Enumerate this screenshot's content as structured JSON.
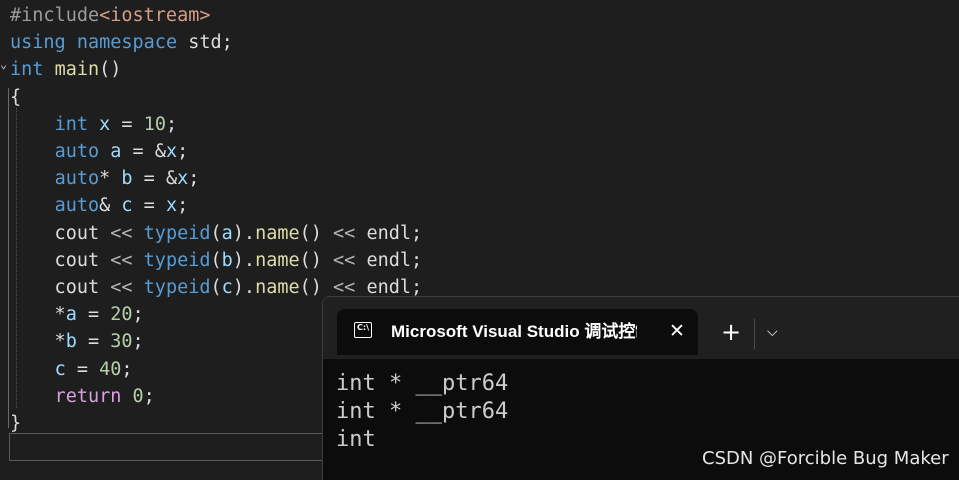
{
  "editor": {
    "lines": [
      [
        {
          "t": "#include",
          "c": "tok-pp"
        },
        {
          "t": "<iostream>",
          "c": "tok-inc"
        }
      ],
      [
        {
          "t": "using",
          "c": "tok-kw"
        },
        {
          "t": " ",
          "c": "tok-plain"
        },
        {
          "t": "namespace",
          "c": "tok-kw"
        },
        {
          "t": " std;",
          "c": "tok-plain"
        }
      ],
      [
        {
          "t": "int",
          "c": "tok-kw"
        },
        {
          "t": " ",
          "c": "tok-plain"
        },
        {
          "t": "main",
          "c": "tok-fn"
        },
        {
          "t": "()",
          "c": "tok-plain"
        }
      ],
      [
        {
          "t": "{",
          "c": "tok-plain"
        }
      ],
      [
        {
          "t": "    ",
          "c": "tok-plain"
        },
        {
          "t": "int",
          "c": "tok-kw"
        },
        {
          "t": " ",
          "c": "tok-plain"
        },
        {
          "t": "x",
          "c": "tok-var"
        },
        {
          "t": " = ",
          "c": "tok-plain"
        },
        {
          "t": "10",
          "c": "tok-num"
        },
        {
          "t": ";",
          "c": "tok-plain"
        }
      ],
      [
        {
          "t": "    ",
          "c": "tok-plain"
        },
        {
          "t": "auto",
          "c": "tok-kw"
        },
        {
          "t": " ",
          "c": "tok-plain"
        },
        {
          "t": "a",
          "c": "tok-var"
        },
        {
          "t": " = &",
          "c": "tok-plain"
        },
        {
          "t": "x",
          "c": "tok-var"
        },
        {
          "t": ";",
          "c": "tok-plain"
        }
      ],
      [
        {
          "t": "    ",
          "c": "tok-plain"
        },
        {
          "t": "auto",
          "c": "tok-kw"
        },
        {
          "t": "* ",
          "c": "tok-plain"
        },
        {
          "t": "b",
          "c": "tok-var"
        },
        {
          "t": " = &",
          "c": "tok-plain"
        },
        {
          "t": "x",
          "c": "tok-var"
        },
        {
          "t": ";",
          "c": "tok-plain"
        }
      ],
      [
        {
          "t": "    ",
          "c": "tok-plain"
        },
        {
          "t": "auto",
          "c": "tok-kw"
        },
        {
          "t": "& ",
          "c": "tok-plain"
        },
        {
          "t": "c",
          "c": "tok-var"
        },
        {
          "t": " = ",
          "c": "tok-plain"
        },
        {
          "t": "x",
          "c": "tok-var"
        },
        {
          "t": ";",
          "c": "tok-plain"
        }
      ],
      [
        {
          "t": "    cout ",
          "c": "tok-plain"
        },
        {
          "t": "<<",
          "c": "tok-op"
        },
        {
          "t": " ",
          "c": "tok-plain"
        },
        {
          "t": "typeid",
          "c": "tok-kw"
        },
        {
          "t": "(",
          "c": "tok-plain"
        },
        {
          "t": "a",
          "c": "tok-var"
        },
        {
          "t": ").",
          "c": "tok-plain"
        },
        {
          "t": "name",
          "c": "tok-fn"
        },
        {
          "t": "() ",
          "c": "tok-plain"
        },
        {
          "t": "<<",
          "c": "tok-op"
        },
        {
          "t": " endl;",
          "c": "tok-plain"
        }
      ],
      [
        {
          "t": "    cout ",
          "c": "tok-plain"
        },
        {
          "t": "<<",
          "c": "tok-op"
        },
        {
          "t": " ",
          "c": "tok-plain"
        },
        {
          "t": "typeid",
          "c": "tok-kw"
        },
        {
          "t": "(",
          "c": "tok-plain"
        },
        {
          "t": "b",
          "c": "tok-var"
        },
        {
          "t": ").",
          "c": "tok-plain"
        },
        {
          "t": "name",
          "c": "tok-fn"
        },
        {
          "t": "() ",
          "c": "tok-plain"
        },
        {
          "t": "<<",
          "c": "tok-op"
        },
        {
          "t": " endl;",
          "c": "tok-plain"
        }
      ],
      [
        {
          "t": "    cout ",
          "c": "tok-plain"
        },
        {
          "t": "<<",
          "c": "tok-op"
        },
        {
          "t": " ",
          "c": "tok-plain"
        },
        {
          "t": "typeid",
          "c": "tok-kw"
        },
        {
          "t": "(",
          "c": "tok-plain"
        },
        {
          "t": "c",
          "c": "tok-var"
        },
        {
          "t": ").",
          "c": "tok-plain"
        },
        {
          "t": "name",
          "c": "tok-fn"
        },
        {
          "t": "() ",
          "c": "tok-plain"
        },
        {
          "t": "<<",
          "c": "tok-op"
        },
        {
          "t": " endl;",
          "c": "tok-plain"
        }
      ],
      [
        {
          "t": "    *",
          "c": "tok-plain"
        },
        {
          "t": "a",
          "c": "tok-var"
        },
        {
          "t": " = ",
          "c": "tok-plain"
        },
        {
          "t": "20",
          "c": "tok-num"
        },
        {
          "t": ";",
          "c": "tok-plain"
        }
      ],
      [
        {
          "t": "    *",
          "c": "tok-plain"
        },
        {
          "t": "b",
          "c": "tok-var"
        },
        {
          "t": " = ",
          "c": "tok-plain"
        },
        {
          "t": "30",
          "c": "tok-num"
        },
        {
          "t": ";",
          "c": "tok-plain"
        }
      ],
      [
        {
          "t": "    ",
          "c": "tok-plain"
        },
        {
          "t": "c",
          "c": "tok-var"
        },
        {
          "t": " = ",
          "c": "tok-plain"
        },
        {
          "t": "40",
          "c": "tok-num"
        },
        {
          "t": ";",
          "c": "tok-plain"
        }
      ],
      [
        {
          "t": "    ",
          "c": "tok-plain"
        },
        {
          "t": "return",
          "c": "tok-ret"
        },
        {
          "t": " ",
          "c": "tok-plain"
        },
        {
          "t": "0",
          "c": "tok-num"
        },
        {
          "t": ";",
          "c": "tok-plain"
        }
      ],
      [
        {
          "t": "}",
          "c": "tok-plain"
        }
      ]
    ],
    "fold_icon": "chevron-down-icon"
  },
  "terminal": {
    "tab_title": "Microsoft Visual Studio 调试控制台",
    "tab_icon": "console-icon",
    "tab_icon_text": "C:\\",
    "close_symbol": "✕",
    "new_tab_symbol": "+",
    "dropdown_symbol": "⌵",
    "output": [
      "int * __ptr64",
      "int * __ptr64",
      "int"
    ]
  },
  "watermark": "CSDN @Forcible Bug Maker",
  "colors": {
    "editor_bg": "#1e1e1e",
    "keyword": "#569cd6",
    "function": "#dcdcaa",
    "variable": "#9cdcfe",
    "number": "#b5cea8",
    "control": "#d8a0df",
    "include_path": "#d69d85",
    "terminal_bg": "#0c0c0c",
    "tabbar_bg": "#202020"
  }
}
